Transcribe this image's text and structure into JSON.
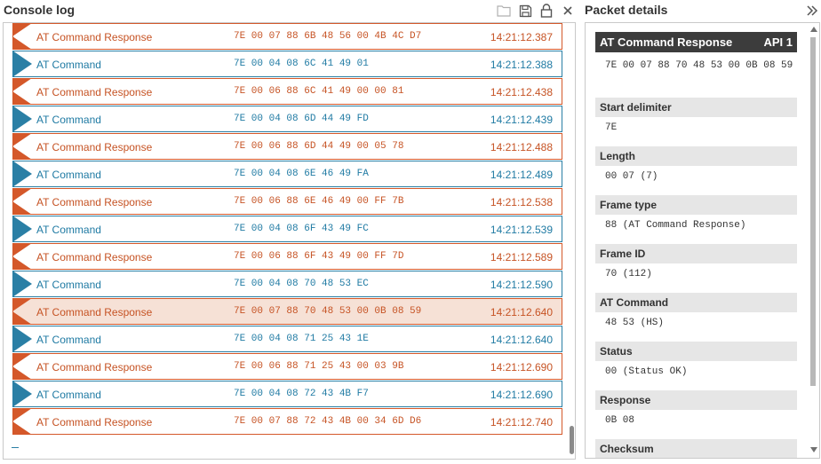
{
  "console": {
    "title": "Console log",
    "icons": [
      "folder-icon",
      "save-icon",
      "lock-icon",
      "close-icon"
    ],
    "frames": [
      {
        "kind": "resp",
        "type": "AT Command Response",
        "hex": "7E 00 07 88 6B 48 56 00 4B 4C D7",
        "time": "14:21:12.387"
      },
      {
        "kind": "req",
        "type": "AT Command",
        "hex": "7E 00 04 08 6C 41 49 01",
        "time": "14:21:12.388"
      },
      {
        "kind": "resp",
        "type": "AT Command Response",
        "hex": "7E 00 06 88 6C 41 49 00 00 81",
        "time": "14:21:12.438"
      },
      {
        "kind": "req",
        "type": "AT Command",
        "hex": "7E 00 04 08 6D 44 49 FD",
        "time": "14:21:12.439"
      },
      {
        "kind": "resp",
        "type": "AT Command Response",
        "hex": "7E 00 06 88 6D 44 49 00 05 78",
        "time": "14:21:12.488"
      },
      {
        "kind": "req",
        "type": "AT Command",
        "hex": "7E 00 04 08 6E 46 49 FA",
        "time": "14:21:12.489"
      },
      {
        "kind": "resp",
        "type": "AT Command Response",
        "hex": "7E 00 06 88 6E 46 49 00 FF 7B",
        "time": "14:21:12.538"
      },
      {
        "kind": "req",
        "type": "AT Command",
        "hex": "7E 00 04 08 6F 43 49 FC",
        "time": "14:21:12.539"
      },
      {
        "kind": "resp",
        "type": "AT Command Response",
        "hex": "7E 00 06 88 6F 43 49 00 FF 7D",
        "time": "14:21:12.589"
      },
      {
        "kind": "req",
        "type": "AT Command",
        "hex": "7E 00 04 08 70 48 53 EC",
        "time": "14:21:12.590"
      },
      {
        "kind": "resp",
        "type": "AT Command Response",
        "hex": "7E 00 07 88 70 48 53 00 0B 08 59",
        "time": "14:21:12.640",
        "selected": true
      },
      {
        "kind": "req",
        "type": "AT Command",
        "hex": "7E 00 04 08 71 25 43 1E",
        "time": "14:21:12.640"
      },
      {
        "kind": "resp",
        "type": "AT Command Response",
        "hex": "7E 00 06 88 71 25 43 00 03 9B",
        "time": "14:21:12.690"
      },
      {
        "kind": "req",
        "type": "AT Command",
        "hex": "7E 00 04 08 72 43 4B F7",
        "time": "14:21:12.690"
      },
      {
        "kind": "resp",
        "type": "AT Command Response",
        "hex": "7E 00 07 88 72 43 4B 00 34 6D D6",
        "time": "14:21:12.740"
      }
    ]
  },
  "details": {
    "title": "Packet details",
    "collapse_icon": "chevron-double-right-icon",
    "summary": {
      "title": "AT Command Response",
      "api": "API 1",
      "hex": "7E 00 07 88 70 48 53 00 0B 08 59"
    },
    "fields": [
      {
        "label": "Start delimiter",
        "value": "7E"
      },
      {
        "label": "Length",
        "value": "00 07 (7)"
      },
      {
        "label": "Frame type",
        "value": "88 (AT Command Response)"
      },
      {
        "label": "Frame ID",
        "value": "70 (112)"
      },
      {
        "label": "AT Command",
        "value": "48 53 (HS)"
      },
      {
        "label": "Status",
        "value": "00 (Status OK)"
      },
      {
        "label": "Response",
        "value": "0B 08"
      },
      {
        "label": "Checksum",
        "value": ""
      }
    ]
  },
  "colors": {
    "response": "#d4582a",
    "request": "#2a7fa5",
    "selected_bg": "#f6e1d6"
  }
}
